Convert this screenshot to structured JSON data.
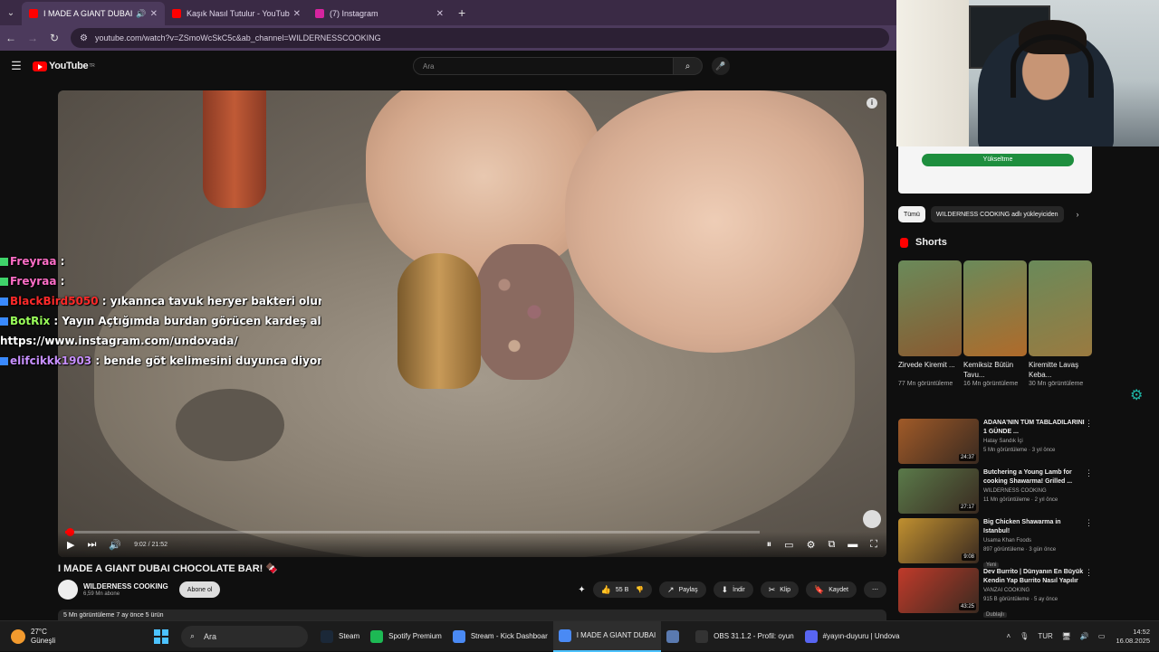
{
  "browser": {
    "tabs": [
      {
        "title": "I MADE A GIANT DUBAI CH",
        "active": true
      },
      {
        "title": "Kaşık Nasıl Tutulur - YouTube",
        "active": false
      },
      {
        "title": "(7) Instagram",
        "active": false
      }
    ],
    "url": "youtube.com/watch?v=ZSmoWcSkC5c&ab_channel=WILDERNESSCOOKING"
  },
  "youtube": {
    "logo": "YouTube",
    "logo_sup": "TR",
    "search_placeholder": "Ara"
  },
  "chat": [
    {
      "user": "Freyraa",
      "color": "#ff6ec7",
      "sep": " :",
      "msg": ""
    },
    {
      "user": "Freyraa",
      "color": "#ff6ec7",
      "sep": " :",
      "msg": ""
    },
    {
      "user": "BlackBird5050",
      "color": "#ff2a2a",
      "sep": " :",
      "msg": " yıkannca tavuk heryer bakteri olurb tavukda"
    },
    {
      "user": "BotRix",
      "color": "#9aff5a",
      "sep": " :",
      "msg": " Yayın Açtığımda burdan görücen kardeş al sana"
    },
    {
      "user": "",
      "color": "#fff",
      "sep": "",
      "msg": "https://www.instagram.com/undovada/"
    },
    {
      "user": "elifcikkk1903",
      "color": "#c890ff",
      "sep": " :",
      "msg": " bende göt kelimesini duyunca diyom a"
    }
  ],
  "player": {
    "time": "9:02 / 21:52",
    "progress": 0.007
  },
  "video": {
    "title": "I MADE A GIANT DUBAI CHOCOLATE BAR! 🍫",
    "channel": "WILDERNESS COOKING",
    "subs": "6,59 Mn abone",
    "subscribe": "Abone ol",
    "likes": "55 B",
    "share": "Paylaş",
    "download": "İndir",
    "clip": "Klip",
    "save": "Kaydet",
    "meta": "5 Mn görüntüleme  7 ay önce  5 ürün"
  },
  "sidebar": {
    "promo_button": "Yükseltme",
    "filters": [
      "Tümü",
      "WILDERNESS COOKING adlı yükleyiciden"
    ],
    "shorts_title": "Shorts",
    "shorts": [
      {
        "title": "Zirvede Kiremit ...",
        "views": "77 Mn görüntüleme",
        "color": "#8a5a30"
      },
      {
        "title": "Kemiksiz Bütün Tavu...",
        "views": "16 Mn görüntüleme",
        "color": "#b06a2a"
      },
      {
        "title": "Kiremitte Lavaş Keba...",
        "views": "30 Mn görüntüleme",
        "color": "#9a7a40"
      }
    ],
    "recs": [
      {
        "title": "ADANA'NIN TÜM TABLADILARINI 1 GÜNDE ...",
        "channel": "Hatay Sandık İçi",
        "meta": "5 Mn görüntüleme · 3 yıl önce",
        "dur": "24:37",
        "color": "#a05a28",
        "tag": ""
      },
      {
        "title": "Butchering a Young Lamb for cooking Shawarma! Grilled ...",
        "channel": "WILDERNESS COOKING",
        "meta": "11 Mn görüntüleme · 2 yıl önce",
        "dur": "27:17",
        "color": "#5a7a4a",
        "tag": ""
      },
      {
        "title": "Big Chicken Shawarma in Istanbul!",
        "channel": "Usama Khan Foods",
        "meta": "897 görüntüleme · 3 gün önce",
        "dur": "9:08",
        "color": "#c09030",
        "tag": "Yeni"
      },
      {
        "title": "Dev Burrito | Dünyanın En Büyük Kendin Yap Burrito Nasıl Yapılır",
        "channel": "VANZAI COOKING",
        "meta": "915 B görüntüleme · 5 ay önce",
        "dur": "43:25",
        "color": "#c03a2a",
        "tag": "Dublajlı"
      }
    ]
  },
  "taskbar": {
    "temp": "27°C",
    "weather": "Güneşli",
    "search": "Ara",
    "items": [
      {
        "label": "Steam",
        "color": "#1b2838",
        "active": false
      },
      {
        "label": "Spotify Premium",
        "color": "#1db954",
        "active": false
      },
      {
        "label": "Stream - Kick Dashboar",
        "color": "#4a8af4",
        "active": false
      },
      {
        "label": "I MADE A GIANT DUBAI",
        "color": "#4a8af4",
        "active": true
      },
      {
        "label": "",
        "color": "#5a7ab0",
        "active": false
      },
      {
        "label": "OBS 31.1.2 - Profil: oyun",
        "color": "#333333",
        "active": false
      },
      {
        "label": "#yayın-duyuru | Undova",
        "color": "#5865f2",
        "active": false
      }
    ],
    "lang": "TUR",
    "time": "14:52",
    "date": "16.08.2025"
  }
}
